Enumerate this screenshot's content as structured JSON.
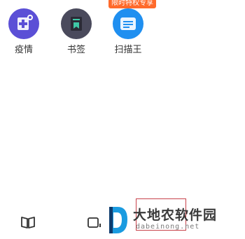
{
  "apps": [
    {
      "label": "疫情",
      "icon": "plus-doc-icon",
      "color": "#5b4fd6"
    },
    {
      "label": "书签",
      "icon": "bookmark-icon",
      "color": "#4a4a5c"
    },
    {
      "label": "扫描王",
      "icon": "scan-doc-icon",
      "color": "#1f8ff0",
      "badge": "限时特权专享"
    }
  ],
  "bottom_bar": {
    "book_icon": "book-icon",
    "tabs_icon": "tabs-icon"
  },
  "watermark": {
    "title": "大地农软件园",
    "url": "dabeinong.net"
  }
}
